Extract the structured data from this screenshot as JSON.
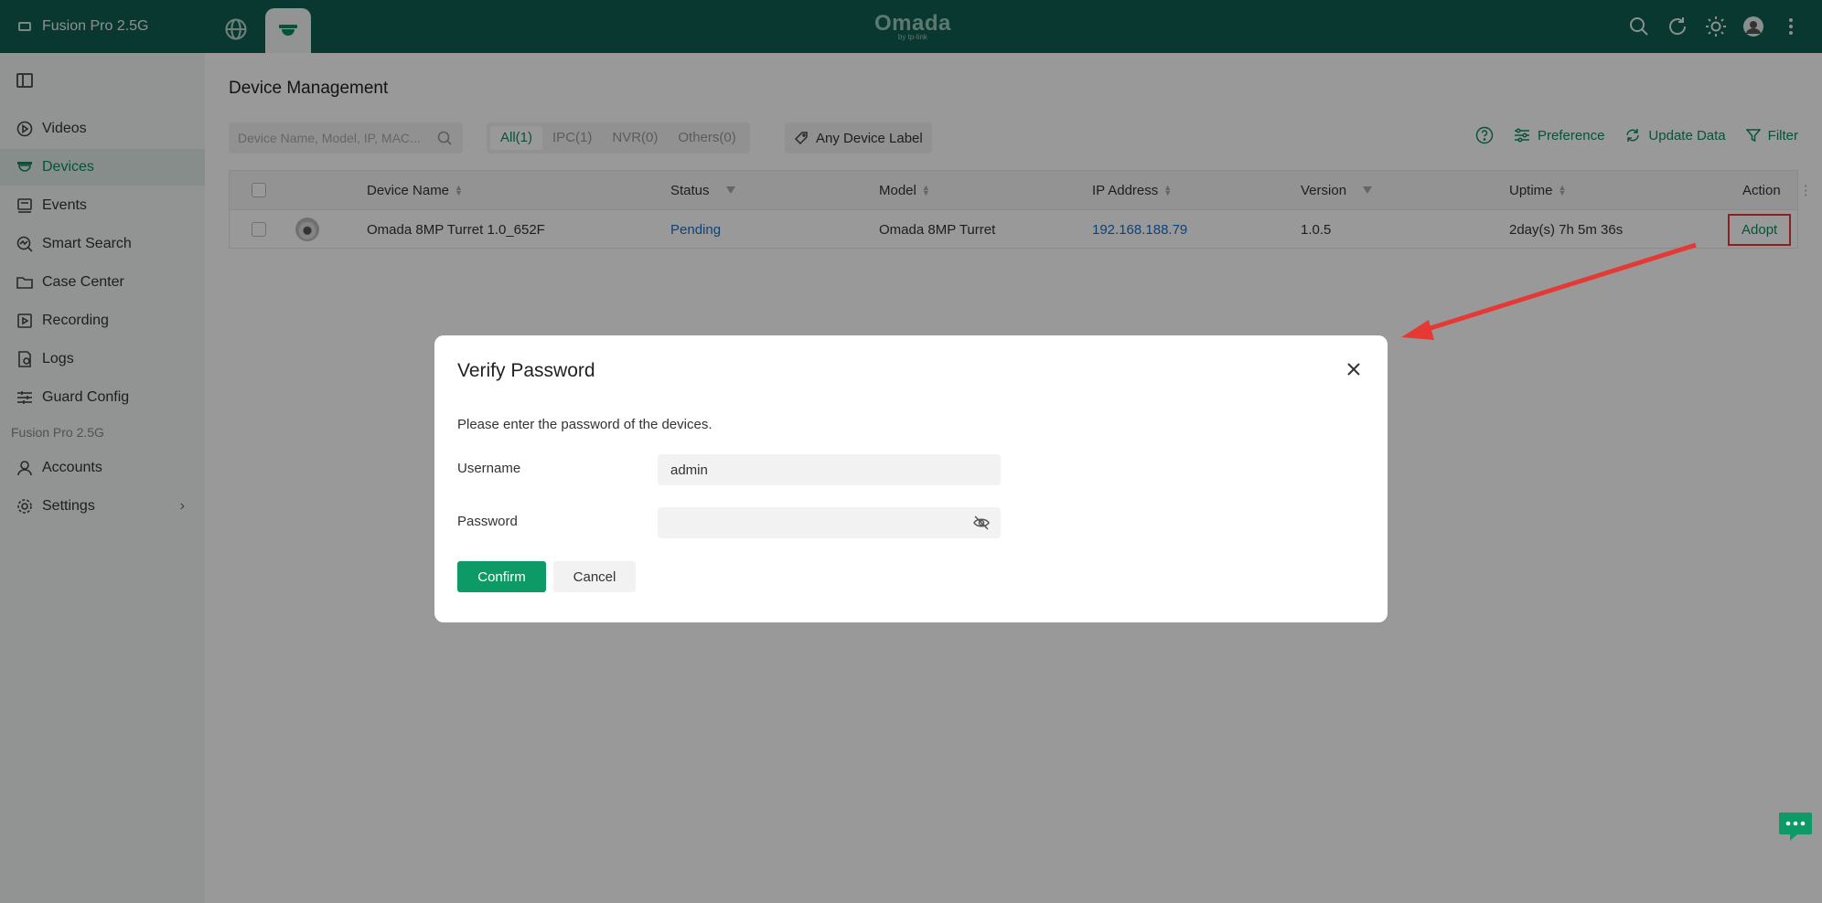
{
  "topbar": {
    "site_name": "Fusion Pro 2.5G",
    "logo": "Omada",
    "logo_sub": "by tp-link",
    "icons": [
      "globe-icon",
      "camera-dome-icon",
      "search-icon",
      "refresh-icon",
      "theme-sun-icon",
      "user-avatar",
      "more-vertical-icon"
    ]
  },
  "sidebar": {
    "items": [
      {
        "label": "Videos",
        "icon": "play-circle-icon"
      },
      {
        "label": "Devices",
        "icon": "camera-dome-icon",
        "active": true
      },
      {
        "label": "Events",
        "icon": "events-icon"
      },
      {
        "label": "Smart Search",
        "icon": "smart-search-icon"
      },
      {
        "label": "Case Center",
        "icon": "folder-icon"
      },
      {
        "label": "Recording",
        "icon": "recording-icon"
      },
      {
        "label": "Logs",
        "icon": "logs-icon"
      },
      {
        "label": "Guard Config",
        "icon": "sliders-icon"
      }
    ],
    "section_label": "Fusion Pro 2.5G",
    "bottom_items": [
      {
        "label": "Accounts",
        "icon": "user-icon"
      },
      {
        "label": "Settings",
        "icon": "gear-icon"
      }
    ]
  },
  "main": {
    "title": "Device Management",
    "search_placeholder": "Device Name, Model, IP, MAC...",
    "filter_tabs": [
      "All(1)",
      "IPC(1)",
      "NVR(0)",
      "Others(0)"
    ],
    "label_button": "Any Device Label",
    "toolbar": {
      "preference": "Preference",
      "update": "Update Data",
      "filter": "Filter"
    },
    "table": {
      "headers": [
        "Device Name",
        "Status",
        "Model",
        "IP Address",
        "Version",
        "Uptime",
        "Action"
      ],
      "rows": [
        {
          "device_name": "Omada 8MP Turret 1.0_652F",
          "status": "Pending",
          "model": "Omada 8MP Turret",
          "ip": "192.168.188.79",
          "version": "1.0.5",
          "uptime": "2day(s) 7h 5m 36s",
          "action": "Adopt"
        }
      ]
    }
  },
  "modal": {
    "title": "Verify Password",
    "description": "Please enter the password of the devices.",
    "username_label": "Username",
    "username_value": "admin",
    "password_label": "Password",
    "password_value": "",
    "confirm": "Confirm",
    "cancel": "Cancel"
  },
  "colors": {
    "topbar": "#0e5e4f",
    "accent": "#0e9a66",
    "link": "#1a6fc9",
    "highlight": "#e53935"
  }
}
